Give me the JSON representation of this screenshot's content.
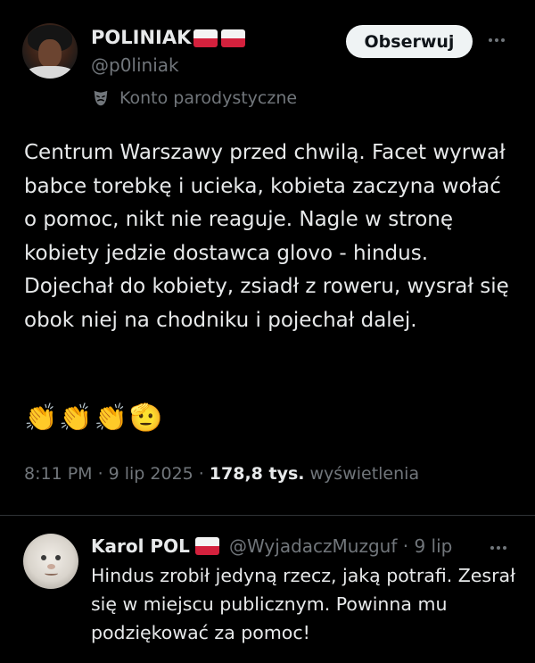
{
  "post": {
    "author_name": "POLINIAK",
    "author_handle": "@p0liniak",
    "parody_label": "Konto parodystyczne",
    "follow_label": "Obserwuj",
    "text": "Centrum Warszawy przed chwilą. Facet wyrwał babce torebkę i ucieka, kobieta zaczyna wołać o pomoc, nikt nie reaguje. Nagle w stronę kobiety jedzie dostawca glovo - hindus. Dojechał do kobiety, zsiadł z roweru, wysrał się obok niej na chodniku i pojechał dalej.",
    "emojis": [
      "👏",
      "👏",
      "👏",
      "🫡"
    ],
    "time": "8:11 PM",
    "date": "9 lip 2025",
    "separator": "·",
    "views_count": "178,8 tys.",
    "views_label": "wyświetlenia"
  },
  "reply": {
    "author_name": "Karol POL",
    "author_handle": "@WyjadaczMuzguf",
    "separator": "·",
    "date": "9 lip",
    "text": "Hindus zrobił jedyną rzecz, jaką potrafi. Zesrał się w miejscu publicznym. Powinna mu podziękować za pomoc!"
  },
  "icons": {
    "flag": "poland-flag-icon",
    "parody": "theater-mask-icon",
    "more": "more-options-icon"
  },
  "colors": {
    "background": "#000000",
    "text_primary": "#e7e9ea",
    "text_secondary": "#71767b",
    "follow_button_bg": "#eff3f4",
    "divider": "#2f3336",
    "flag_red": "#d4213d"
  }
}
